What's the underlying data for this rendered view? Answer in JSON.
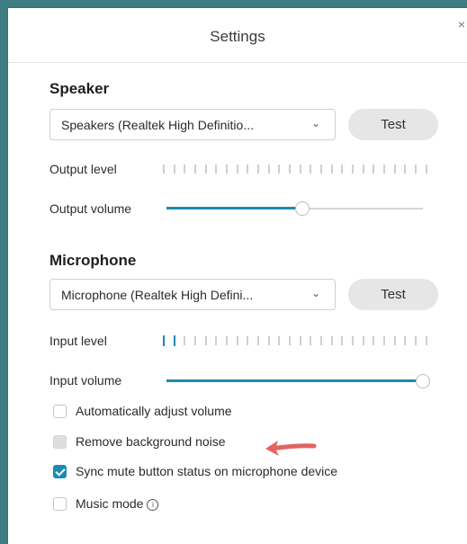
{
  "window": {
    "title": "Settings",
    "close_glyph": "×"
  },
  "speaker": {
    "heading": "Speaker",
    "device": "Speakers (Realtek High Definitio...",
    "test_label": "Test",
    "output_level_label": "Output level",
    "output_level_active_bars": 0,
    "output_volume_label": "Output volume",
    "output_volume_fraction": 0.53
  },
  "microphone": {
    "heading": "Microphone",
    "device": "Microphone (Realtek High Defini...",
    "test_label": "Test",
    "input_level_label": "Input level",
    "input_level_active_bars": 2,
    "input_volume_label": "Input volume",
    "input_volume_fraction": 1.0
  },
  "options": [
    {
      "label": "Automatically adjust volume",
      "state": "unchecked"
    },
    {
      "label": "Remove background noise",
      "state": "disabled"
    },
    {
      "label": "Sync mute button status on microphone device",
      "state": "checked"
    },
    {
      "label": "Music mode",
      "state": "unchecked",
      "info_icon": "info-icon"
    }
  ],
  "colors": {
    "accent": "#1a8cb0",
    "frame": "#3e7d83",
    "annotation_arrow": "#e5635f"
  }
}
